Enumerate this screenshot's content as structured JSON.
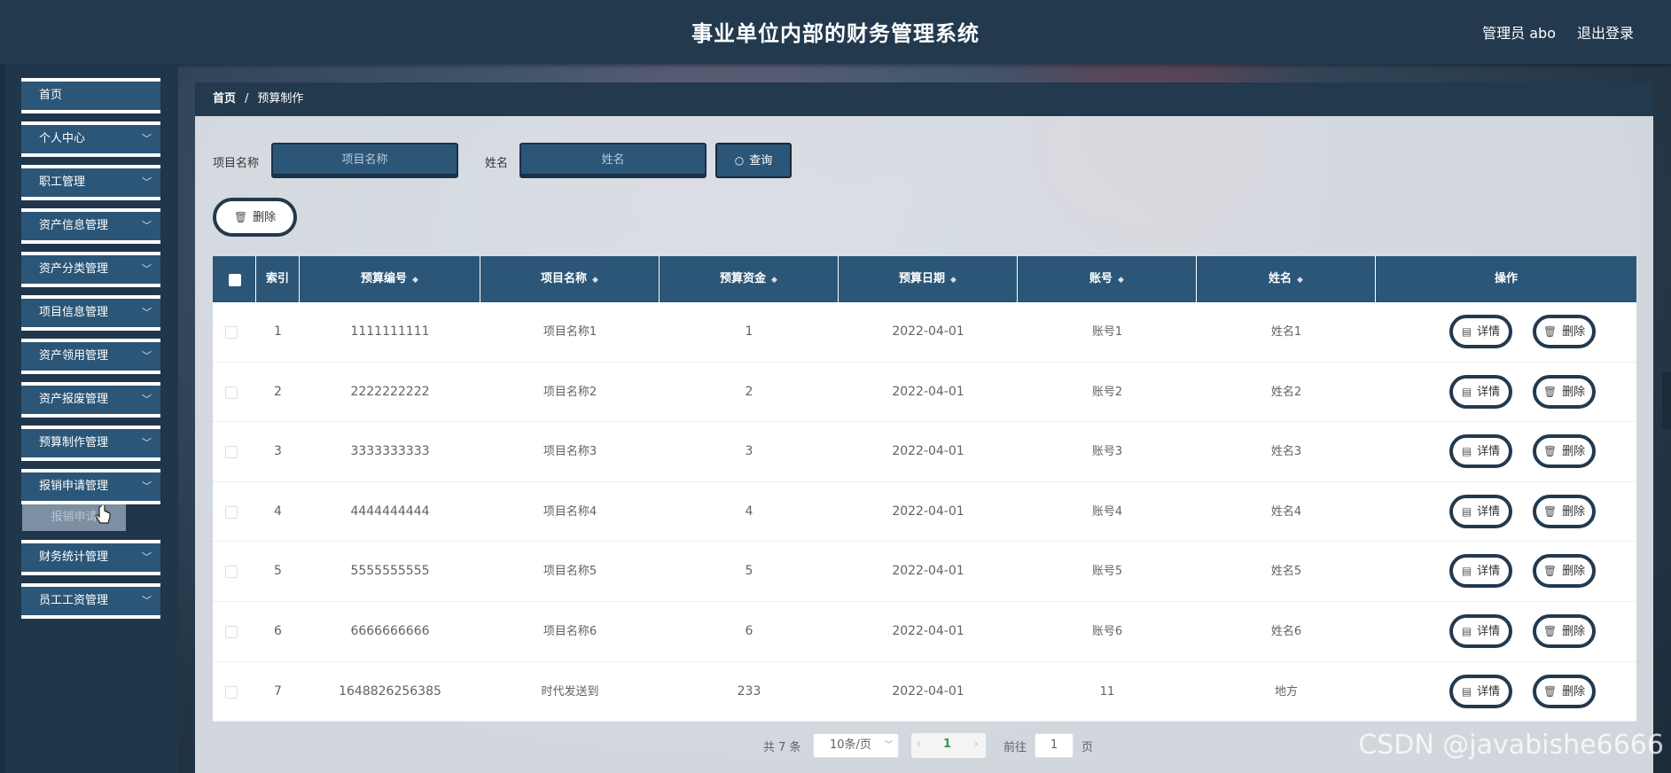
{
  "header": {
    "title": "事业单位内部的财务管理系统",
    "user": "管理员 abo",
    "logout": "退出登录"
  },
  "sidebar": {
    "items": [
      {
        "label": "首页"
      },
      {
        "label": "个人中心"
      },
      {
        "label": "职工管理"
      },
      {
        "label": "资产信息管理"
      },
      {
        "label": "资产分类管理"
      },
      {
        "label": "项目信息管理"
      },
      {
        "label": "资产领用管理"
      },
      {
        "label": "资产报废管理"
      },
      {
        "label": "预算制作管理"
      },
      {
        "label": "报销申请管理"
      },
      {
        "label": "财务统计管理"
      },
      {
        "label": "员工工资管理"
      }
    ],
    "submenu_label": "报销申请"
  },
  "breadcrumb": {
    "home": "首页",
    "current": "预算制作"
  },
  "search": {
    "project_label": "项目名称",
    "project_placeholder": "项目名称",
    "name_label": "姓名",
    "name_placeholder": "姓名",
    "query_label": "查询"
  },
  "toolbar": {
    "delete_label": "删除"
  },
  "table": {
    "headers": {
      "index": "索引",
      "code": "预算编号",
      "project": "项目名称",
      "fund": "预算资金",
      "date": "预算日期",
      "account": "账号",
      "name": "姓名",
      "ops": "操作"
    },
    "rows": [
      {
        "index": "1",
        "code": "1111111111",
        "project": "项目名称1",
        "fund": "1",
        "date": "2022-04-01",
        "account": "账号1",
        "name": "姓名1"
      },
      {
        "index": "2",
        "code": "2222222222",
        "project": "项目名称2",
        "fund": "2",
        "date": "2022-04-01",
        "account": "账号2",
        "name": "姓名2"
      },
      {
        "index": "3",
        "code": "3333333333",
        "project": "项目名称3",
        "fund": "3",
        "date": "2022-04-01",
        "account": "账号3",
        "name": "姓名3"
      },
      {
        "index": "4",
        "code": "4444444444",
        "project": "项目名称4",
        "fund": "4",
        "date": "2022-04-01",
        "account": "账号4",
        "name": "姓名4"
      },
      {
        "index": "5",
        "code": "5555555555",
        "project": "项目名称5",
        "fund": "5",
        "date": "2022-04-01",
        "account": "账号5",
        "name": "姓名5"
      },
      {
        "index": "6",
        "code": "6666666666",
        "project": "项目名称6",
        "fund": "6",
        "date": "2022-04-01",
        "account": "账号6",
        "name": "姓名6"
      },
      {
        "index": "7",
        "code": "1648826256385",
        "project": "时代发送到",
        "fund": "233",
        "date": "2022-04-01",
        "account": "11",
        "name": "地方"
      }
    ],
    "detail_label": "详情",
    "delete_label": "删除"
  },
  "pagination": {
    "total": "共 7 条",
    "page_size": "10条/页",
    "current_page": "1",
    "goto_label": "前往",
    "goto_value": "1",
    "page_unit": "页"
  },
  "watermark": "CSDN @javabishe6666"
}
